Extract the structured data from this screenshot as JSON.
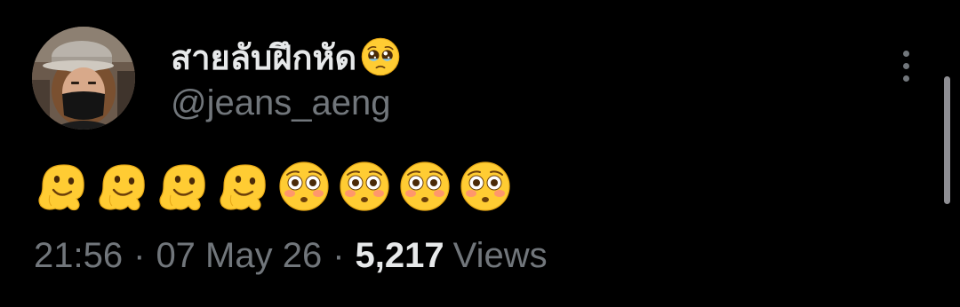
{
  "author": {
    "display_name": "สายลับฝึกหัด",
    "name_emoji": "pleading-face",
    "handle": "@jeans_aeng"
  },
  "tweet": {
    "emojis": [
      "melting-face",
      "melting-face",
      "melting-face",
      "melting-face",
      "flushed-face",
      "flushed-face",
      "flushed-face",
      "flushed-face"
    ]
  },
  "meta": {
    "time": "21:56",
    "separator": "·",
    "date": "07 May 26",
    "views_count": "5,217",
    "views_label": "Views"
  },
  "colors": {
    "background": "#000000",
    "primary_text": "#e7e9ea",
    "secondary_text": "#71767b",
    "emoji_yellow": "#ffcc33"
  }
}
